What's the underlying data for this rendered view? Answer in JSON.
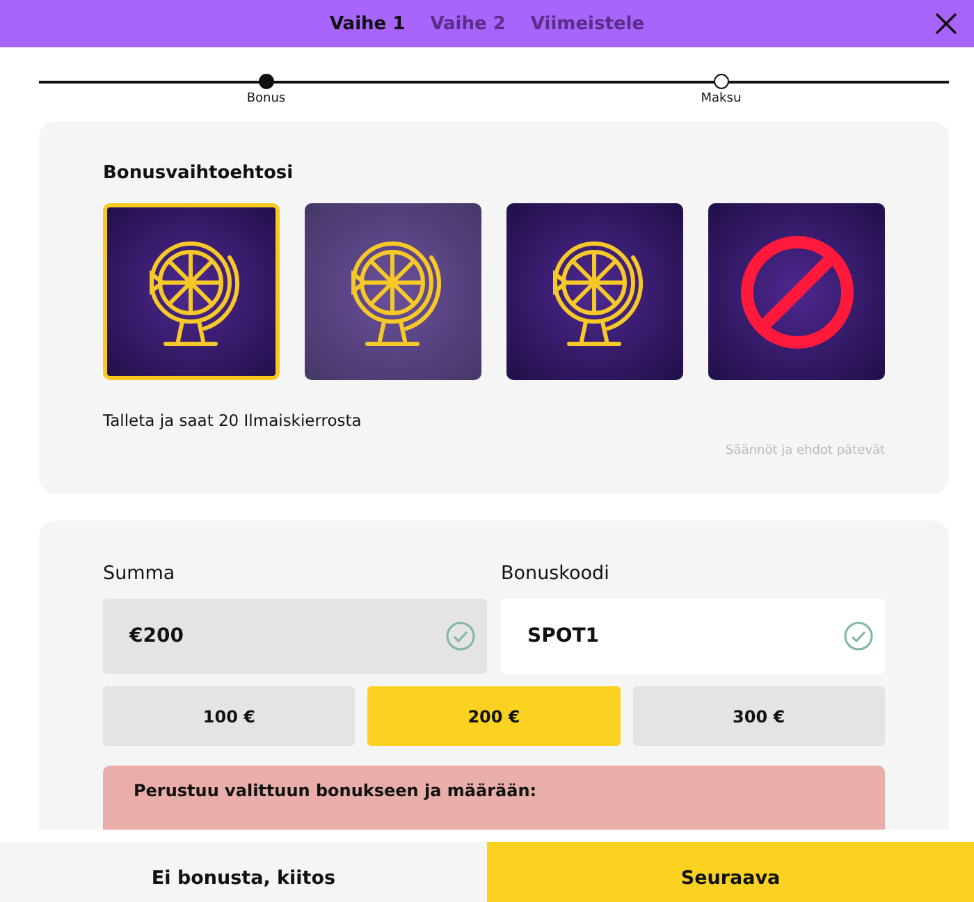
{
  "header": {
    "tabs": [
      {
        "label": "Vaihe 1",
        "selected": true
      },
      {
        "label": "Vaihe 2",
        "selected": false
      },
      {
        "label": "Viimeistele",
        "selected": false
      }
    ]
  },
  "stepper": [
    {
      "label": "Bonus",
      "done": true
    },
    {
      "label": "Maksu",
      "done": false
    }
  ],
  "bonus": {
    "title": "Bonusvaihtoehtosi",
    "options": [
      {
        "kind": "wheel",
        "selected": true,
        "hovered": false
      },
      {
        "kind": "wheel",
        "selected": false,
        "hovered": true
      },
      {
        "kind": "wheel",
        "selected": false,
        "hovered": false
      },
      {
        "kind": "none",
        "selected": false,
        "hovered": false
      }
    ],
    "description": "Talleta ja saat 20 Ilmaiskierrosta",
    "terms": "Säännöt ja ehdot pätevät"
  },
  "payment": {
    "amount": {
      "label": "Summa",
      "value": "€200",
      "valid": true
    },
    "code": {
      "label": "Bonuskoodi",
      "value": "SPOT1",
      "valid": true
    },
    "presets": [
      {
        "label": "100 €",
        "selected": false
      },
      {
        "label": "200 €",
        "selected": true
      },
      {
        "label": "300 €",
        "selected": false
      }
    ],
    "notice": "Perustuu valittuun bonukseen ja määrään:"
  },
  "footer": {
    "buttons": [
      {
        "label": "Ei bonusta, kiitos",
        "kind": "secondary"
      },
      {
        "label": "Seuraava",
        "kind": "primary"
      }
    ]
  }
}
